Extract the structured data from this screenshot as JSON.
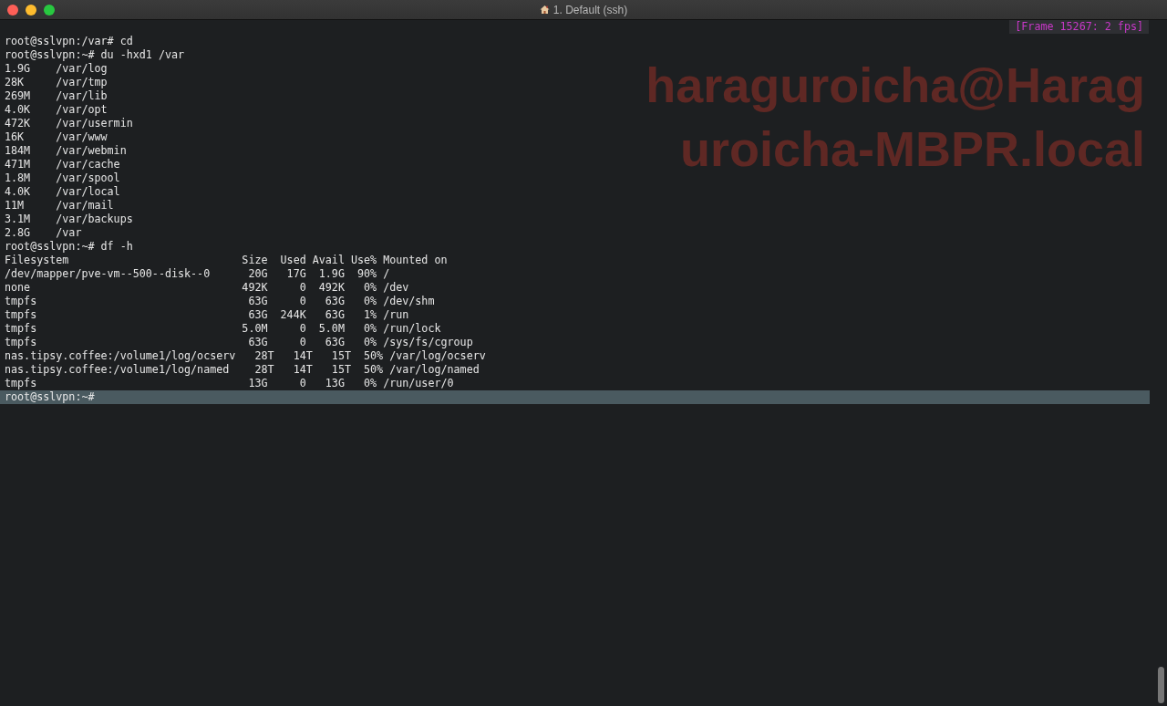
{
  "window": {
    "title": "1. Default (ssh)"
  },
  "frame_indicator": "[Frame 15267: 2 fps]",
  "badge": [
    "haraguroicha@Harag",
    "uroicha-MBPR.local"
  ],
  "lines": [
    {
      "text": "root@sslvpn:/var# cd",
      "highlighted": false
    },
    {
      "text": "root@sslvpn:~# du -hxd1 /var",
      "highlighted": false
    },
    {
      "text": "1.9G    /var/log",
      "highlighted": false
    },
    {
      "text": "28K     /var/tmp",
      "highlighted": false
    },
    {
      "text": "269M    /var/lib",
      "highlighted": false
    },
    {
      "text": "4.0K    /var/opt",
      "highlighted": false
    },
    {
      "text": "472K    /var/usermin",
      "highlighted": false
    },
    {
      "text": "16K     /var/www",
      "highlighted": false
    },
    {
      "text": "184M    /var/webmin",
      "highlighted": false
    },
    {
      "text": "471M    /var/cache",
      "highlighted": false
    },
    {
      "text": "1.8M    /var/spool",
      "highlighted": false
    },
    {
      "text": "4.0K    /var/local",
      "highlighted": false
    },
    {
      "text": "11M     /var/mail",
      "highlighted": false
    },
    {
      "text": "3.1M    /var/backups",
      "highlighted": false
    },
    {
      "text": "2.8G    /var",
      "highlighted": false
    },
    {
      "text": "root@sslvpn:~# df -h",
      "highlighted": false
    },
    {
      "text": "Filesystem                           Size  Used Avail Use% Mounted on",
      "highlighted": false
    },
    {
      "text": "/dev/mapper/pve-vm--500--disk--0      20G   17G  1.9G  90% /",
      "highlighted": false
    },
    {
      "text": "none                                 492K     0  492K   0% /dev",
      "highlighted": false
    },
    {
      "text": "tmpfs                                 63G     0   63G   0% /dev/shm",
      "highlighted": false
    },
    {
      "text": "tmpfs                                 63G  244K   63G   1% /run",
      "highlighted": false
    },
    {
      "text": "tmpfs                                5.0M     0  5.0M   0% /run/lock",
      "highlighted": false
    },
    {
      "text": "tmpfs                                 63G     0   63G   0% /sys/fs/cgroup",
      "highlighted": false
    },
    {
      "text": "nas.tipsy.coffee:/volume1/log/ocserv   28T   14T   15T  50% /var/log/ocserv",
      "highlighted": false
    },
    {
      "text": "nas.tipsy.coffee:/volume1/log/named    28T   14T   15T  50% /var/log/named",
      "highlighted": false
    },
    {
      "text": "tmpfs                                 13G     0   13G   0% /run/user/0",
      "highlighted": false
    },
    {
      "text": "root@sslvpn:~#",
      "highlighted": true
    }
  ]
}
